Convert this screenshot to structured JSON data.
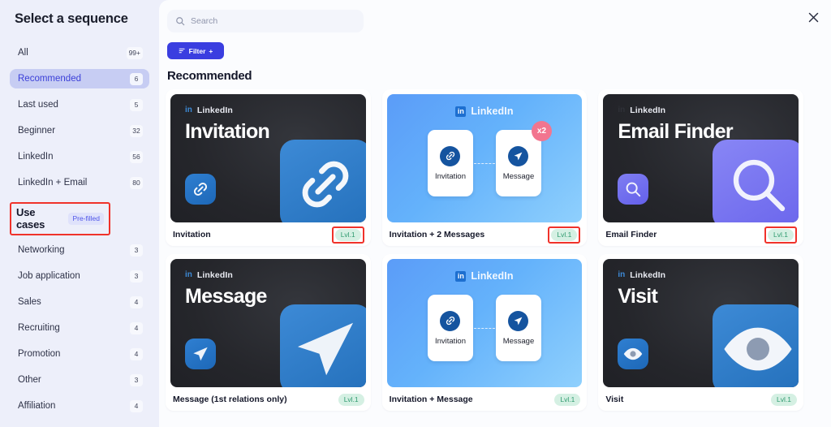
{
  "sidebar": {
    "title": "Select a sequence",
    "items": [
      {
        "label": "All",
        "count": "99+",
        "active": false
      },
      {
        "label": "Recommended",
        "count": "6",
        "active": true
      },
      {
        "label": "Last used",
        "count": "5",
        "active": false
      },
      {
        "label": "Beginner",
        "count": "32",
        "active": false
      },
      {
        "label": "LinkedIn",
        "count": "56",
        "active": false
      },
      {
        "label": "LinkedIn + Email",
        "count": "80",
        "active": false
      }
    ],
    "section": {
      "title": "Use cases",
      "badge": "Pre-filled",
      "highlighted": true
    },
    "use_cases": [
      {
        "label": "Networking",
        "count": "3"
      },
      {
        "label": "Job application",
        "count": "3"
      },
      {
        "label": "Sales",
        "count": "4"
      },
      {
        "label": "Recruiting",
        "count": "4"
      },
      {
        "label": "Promotion",
        "count": "4"
      },
      {
        "label": "Other",
        "count": "3"
      },
      {
        "label": "Affiliation",
        "count": "4"
      }
    ]
  },
  "topbar": {
    "search_placeholder": "Search",
    "search_value": "",
    "search_icon": "search-icon",
    "filter_label": "Filter",
    "filter_icon": "filter-lines-icon",
    "filter_plus": "+",
    "close_icon": "close-icon"
  },
  "main": {
    "section_heading": "Recommended",
    "cards": [
      {
        "name": "Invitation",
        "level": "Lvl.1",
        "level_highlighted": true,
        "style": "dark",
        "brand": "LinkedIn",
        "brand_mark": "in",
        "big_title": "Invitation",
        "icon": "link-icon",
        "icon_color": "#2470bb",
        "layout": "hero"
      },
      {
        "name": "Invitation + 2 Messages",
        "level": "Lvl.1",
        "level_highlighted": true,
        "style": "blue",
        "brand": "LinkedIn",
        "brand_mark": "in",
        "layout": "flow",
        "multiplier": "x2",
        "nodes": [
          {
            "label": "Invitation",
            "icon": "link-icon"
          },
          {
            "label": "Message",
            "icon": "send-icon"
          }
        ]
      },
      {
        "name": "Email Finder",
        "level": "Lvl.1",
        "level_highlighted": true,
        "style": "dark",
        "brand": "LinkedIn",
        "brand_mark": "in",
        "big_title": "Email Finder",
        "icon": "magnifier-icon",
        "icon_color": "#6b66ec",
        "layout": "hero"
      },
      {
        "name": "Message (1st relations only)",
        "level": "Lvl.1",
        "level_highlighted": false,
        "style": "dark",
        "brand": "LinkedIn",
        "brand_mark": "in",
        "big_title": "Message",
        "icon": "send-icon",
        "icon_color": "#2470bb",
        "layout": "hero"
      },
      {
        "name": "Invitation + Message",
        "level": "Lvl.1",
        "level_highlighted": false,
        "style": "blue",
        "brand": "LinkedIn",
        "brand_mark": "in",
        "layout": "flow",
        "multiplier": "",
        "nodes": [
          {
            "label": "Invitation",
            "icon": "link-icon"
          },
          {
            "label": "Message",
            "icon": "send-icon"
          }
        ]
      },
      {
        "name": "Visit",
        "level": "Lvl.1",
        "level_highlighted": false,
        "style": "dark",
        "brand": "LinkedIn",
        "brand_mark": "in",
        "big_title": "Visit",
        "icon": "eye-icon",
        "icon_color": "#2470bb",
        "layout": "hero"
      }
    ]
  },
  "colors": {
    "page_background": "#edeffa",
    "panel_background": "#fbfcfe",
    "accent": "#3a3ee0",
    "active_nav": "#c7cdf3",
    "level_badge_text": "#2f9a6f",
    "level_badge_bg": "#d5f0e3",
    "highlight_outline": "#f0322a",
    "multiplier_badge": "#f2758f"
  }
}
